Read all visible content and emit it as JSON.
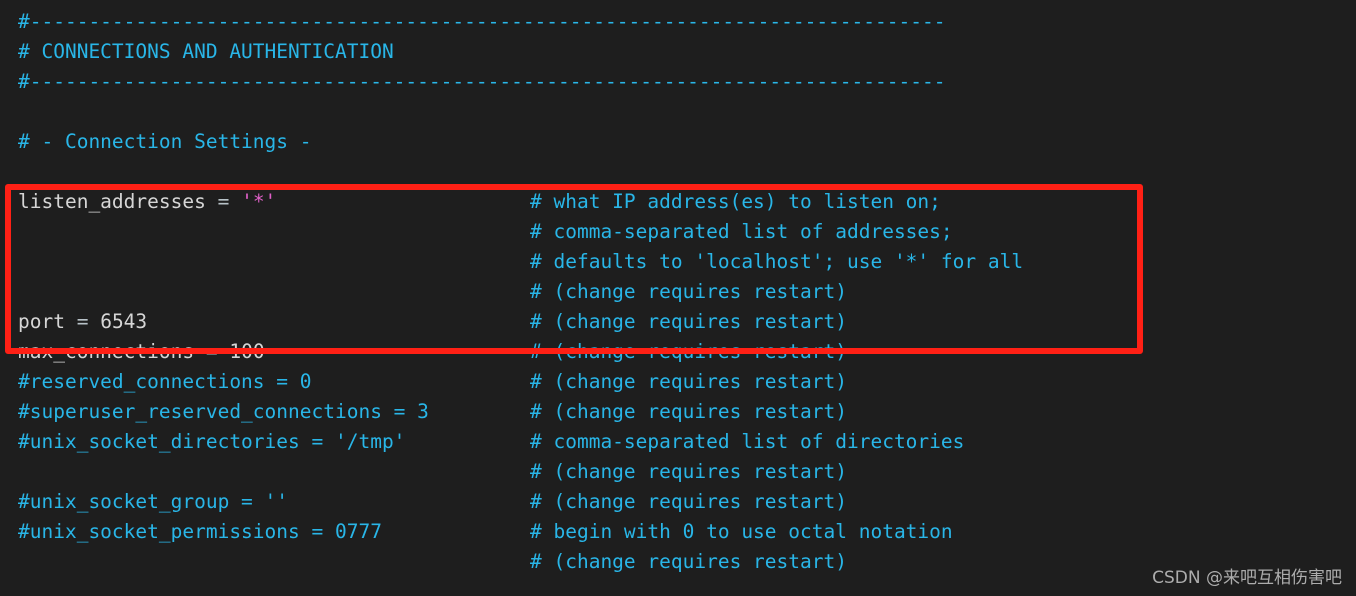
{
  "editor": {
    "background_color": "#1e1e1e",
    "comment_color": "#29b6e8",
    "identifier_color": "#d6d6d6",
    "string_color": "#e060c8",
    "highlight_color": "#ff2015",
    "file_kind": "postgresql.conf"
  },
  "highlight": {
    "label": "red-rectangle-annotation",
    "covers_lines": "listen_addresses through port"
  },
  "watermark": {
    "text": "CSDN @来吧互相伤害吧"
  },
  "lines": [
    {
      "id": "line-1",
      "name": "comment-rule-top",
      "lhs": [
        {
          "t": "#------------------------------------------------------------------------------",
          "c": "comment"
        }
      ],
      "rhs": []
    },
    {
      "id": "line-2",
      "name": "comment-section-title",
      "lhs": [
        {
          "t": "# CONNECTIONS AND AUTHENTICATION",
          "c": "comment"
        }
      ],
      "rhs": []
    },
    {
      "id": "line-3",
      "name": "comment-rule-bottom",
      "lhs": [
        {
          "t": "#------------------------------------------------------------------------------",
          "c": "comment"
        }
      ],
      "rhs": []
    },
    {
      "id": "line-4",
      "name": "blank-line",
      "lhs": [],
      "rhs": []
    },
    {
      "id": "line-5",
      "name": "comment-connection-settings",
      "lhs": [
        {
          "t": "# - Connection Settings -",
          "c": "comment"
        }
      ],
      "rhs": []
    },
    {
      "id": "line-6",
      "name": "blank-line",
      "lhs": [],
      "rhs": []
    },
    {
      "id": "line-7",
      "name": "setting-listen-addresses",
      "lhs": [
        {
          "t": "listen_addresses",
          "c": "key"
        },
        {
          "t": " = ",
          "c": "op"
        },
        {
          "t": "'*'",
          "c": "string"
        }
      ],
      "rhs": [
        {
          "t": "# what IP address(es) to listen on;",
          "c": "comment"
        }
      ]
    },
    {
      "id": "line-8",
      "name": "comment-continuation-1",
      "lhs": [],
      "rhs": [
        {
          "t": "# comma-separated list of addresses;",
          "c": "comment"
        }
      ]
    },
    {
      "id": "line-9",
      "name": "comment-continuation-2",
      "lhs": [],
      "rhs": [
        {
          "t": "# defaults to 'localhost'; use '*' for all",
          "c": "comment"
        }
      ]
    },
    {
      "id": "line-10",
      "name": "comment-continuation-3",
      "lhs": [],
      "rhs": [
        {
          "t": "# (change requires restart)",
          "c": "comment"
        }
      ]
    },
    {
      "id": "line-11",
      "name": "setting-port",
      "lhs": [
        {
          "t": "port",
          "c": "key"
        },
        {
          "t": " = ",
          "c": "op"
        },
        {
          "t": "6543",
          "c": "number"
        }
      ],
      "rhs": [
        {
          "t": "# (change requires restart)",
          "c": "comment"
        }
      ]
    },
    {
      "id": "line-12",
      "name": "setting-max-connections",
      "lhs": [
        {
          "t": "max_connections",
          "c": "key"
        },
        {
          "t": " = ",
          "c": "op"
        },
        {
          "t": "100",
          "c": "number"
        }
      ],
      "rhs": [
        {
          "t": "# (change requires restart)",
          "c": "comment"
        }
      ]
    },
    {
      "id": "line-13",
      "name": "setting-reserved-connections",
      "lhs": [
        {
          "t": "#reserved_connections = 0",
          "c": "comment"
        }
      ],
      "rhs": [
        {
          "t": "# (change requires restart)",
          "c": "comment"
        }
      ]
    },
    {
      "id": "line-14",
      "name": "setting-superuser-reserved-connections",
      "lhs": [
        {
          "t": "#superuser_reserved_connections = 3",
          "c": "comment"
        }
      ],
      "rhs": [
        {
          "t": "# (change requires restart)",
          "c": "comment"
        }
      ]
    },
    {
      "id": "line-15",
      "name": "setting-unix-socket-directories",
      "lhs": [
        {
          "t": "#unix_socket_directories = '/tmp'",
          "c": "comment"
        }
      ],
      "rhs": [
        {
          "t": "# comma-separated list of directories",
          "c": "comment"
        }
      ]
    },
    {
      "id": "line-16",
      "name": "comment-continuation-4",
      "lhs": [],
      "rhs": [
        {
          "t": "# (change requires restart)",
          "c": "comment"
        }
      ]
    },
    {
      "id": "line-17",
      "name": "setting-unix-socket-group",
      "lhs": [
        {
          "t": "#unix_socket_group = ''",
          "c": "comment"
        }
      ],
      "rhs": [
        {
          "t": "# (change requires restart)",
          "c": "comment"
        }
      ]
    },
    {
      "id": "line-18",
      "name": "setting-unix-socket-permissions",
      "lhs": [
        {
          "t": "#unix_socket_permissions = 0777",
          "c": "comment"
        }
      ],
      "rhs": [
        {
          "t": "# begin with 0 to use octal notation",
          "c": "comment"
        }
      ]
    },
    {
      "id": "line-19",
      "name": "comment-continuation-5",
      "lhs": [],
      "rhs": [
        {
          "t": "# (change requires restart)",
          "c": "comment"
        }
      ]
    }
  ]
}
